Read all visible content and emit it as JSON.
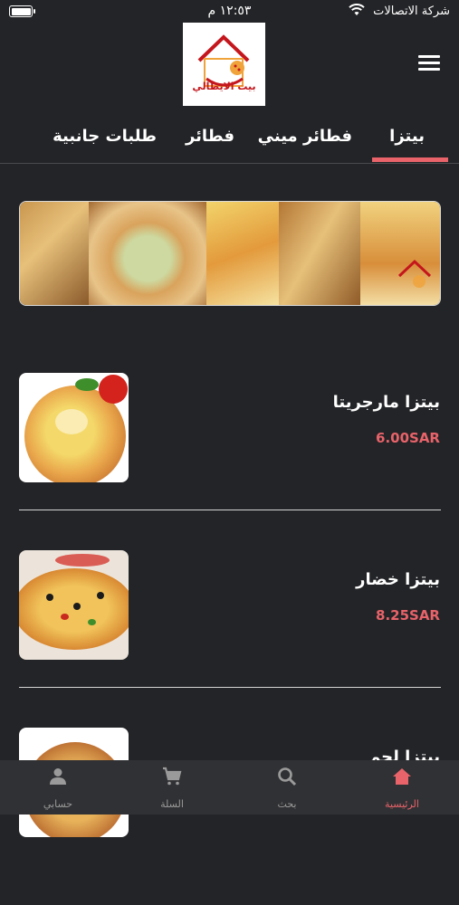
{
  "status_bar": {
    "carrier": "شركة الاتصالات",
    "time": "١٢:٥٣ م"
  },
  "header": {
    "logo_text": "بيت الايطالي",
    "menu_icon": "hamburger-icon"
  },
  "tabs": [
    {
      "label": "بيتزا",
      "active": true
    },
    {
      "label": "فطائر ميني",
      "active": false
    },
    {
      "label": "فطائر",
      "active": false
    },
    {
      "label": "طلبات جانبية",
      "active": false
    }
  ],
  "products": [
    {
      "name": "بيتزا مارجريتا",
      "price": "6.00SAR"
    },
    {
      "name": "بيتزا خضار",
      "price": "8.25SAR"
    },
    {
      "name": "بيتزا لحم",
      "price": ""
    }
  ],
  "bottom_nav": [
    {
      "label": "الرئيسية",
      "icon": "home-icon",
      "active": true
    },
    {
      "label": "بحث",
      "icon": "search-icon",
      "active": false
    },
    {
      "label": "السلة",
      "icon": "cart-icon",
      "active": false
    },
    {
      "label": "حسابي",
      "icon": "user-icon",
      "active": false
    }
  ],
  "colors": {
    "background": "#232427",
    "accent": "#e8636a",
    "nav_bg": "#303134"
  }
}
